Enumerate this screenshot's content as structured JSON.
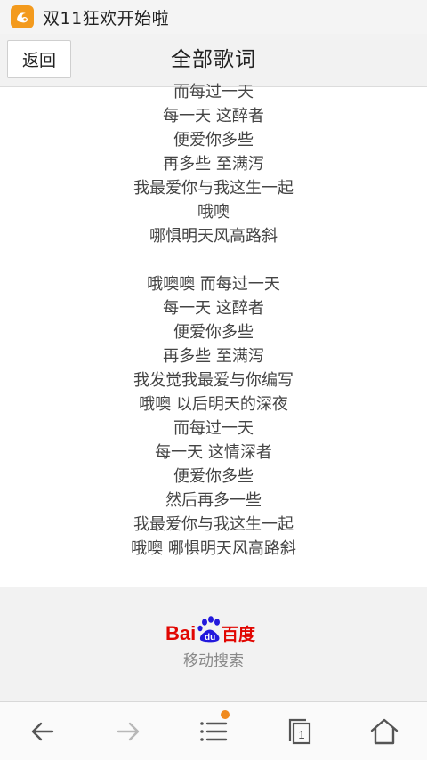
{
  "browser": {
    "tab_title": "双11狂欢开始啦"
  },
  "header": {
    "back_label": "返回",
    "title": "全部歌词"
  },
  "lyrics": {
    "lines": [
      "而每过一天",
      "每一天 这醉者",
      "便爱你多些",
      "再多些 至满泻",
      "我最爱你与我这生一起",
      "哦噢",
      "哪惧明天风高路斜",
      "",
      "哦噢噢 而每过一天",
      "每一天 这醉者",
      "便爱你多些",
      "再多些 至满泻",
      "我发觉我最爱与你编写",
      "哦噢 以后明天的深夜",
      "而每过一天",
      "每一天 这情深者",
      "便爱你多些",
      "然后再多一些",
      "我最爱你与我这生一起",
      "哦噢 哪惧明天风高路斜"
    ]
  },
  "footer": {
    "logo_text_latin_1": "Bai",
    "logo_text_paw": "du",
    "logo_text_cn": "百度",
    "subtitle": "移动搜索"
  },
  "bottom_nav": {
    "tab_count": "1"
  },
  "colors": {
    "uc_orange": "#f39a1d",
    "baidu_red": "#e10601",
    "baidu_blue": "#2319dc",
    "notification_dot": "#f08a1e"
  }
}
